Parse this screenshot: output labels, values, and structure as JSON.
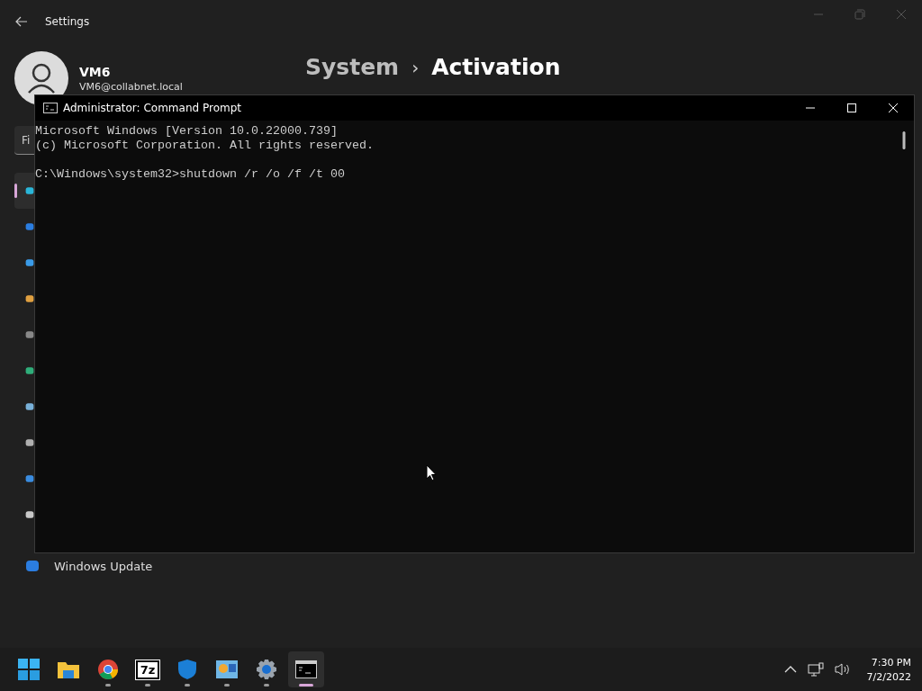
{
  "settings_window": {
    "title": "Settings",
    "user": {
      "name": "VM6",
      "email": "VM6@collabnet.local"
    },
    "breadcrumb": {
      "parent": "System",
      "separator": "›",
      "current": "Activation"
    },
    "search": {
      "value": "Fi"
    },
    "sidebar": {
      "items": [
        {
          "selected": true
        },
        {
          "selected": false
        },
        {
          "selected": false
        },
        {
          "selected": false
        },
        {
          "selected": false
        },
        {
          "selected": false
        },
        {
          "selected": false
        },
        {
          "selected": false
        },
        {
          "selected": false
        },
        {
          "selected": false
        },
        {
          "selected": false,
          "label": "Windows Update"
        }
      ]
    }
  },
  "console_window": {
    "title": "Administrator: Command Prompt",
    "output": [
      "Microsoft Windows [Version 10.0.22000.739]",
      "(c) Microsoft Corporation. All rights reserved."
    ],
    "prompt": "C:\\Windows\\system32>shutdown /r /o /f /t 00"
  },
  "taskbar": {
    "apps": [
      {
        "running": false,
        "selected": false
      },
      {
        "running": false,
        "selected": false
      },
      {
        "running": true,
        "selected": false
      },
      {
        "running": true,
        "selected": false,
        "label": "7z"
      },
      {
        "running": true,
        "selected": false
      },
      {
        "running": true,
        "selected": false
      },
      {
        "running": true,
        "selected": false
      },
      {
        "running": true,
        "selected": true
      }
    ],
    "clock": {
      "time": "7:30 PM",
      "date": "7/2/2022"
    }
  }
}
